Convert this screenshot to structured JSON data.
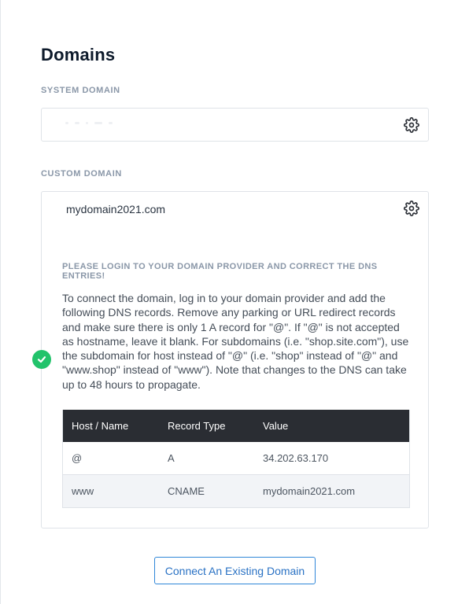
{
  "page": {
    "title": "Domains"
  },
  "system_domain": {
    "label": "SYSTEM DOMAIN",
    "settings_icon": "gear-icon"
  },
  "custom_domain": {
    "label": "CUSTOM DOMAIN",
    "value": "mydomain2021.com",
    "settings_icon": "gear-icon",
    "status_icon": "check-circle-icon",
    "status_color": "#22c36b",
    "warning_title": "PLEASE LOGIN TO YOUR DOMAIN PROVIDER AND CORRECT THE DNS ENTRIES!",
    "instructions": "To connect the domain, log in to your domain provider and add the following DNS records. Remove any parking or URL redirect records and make sure there is only 1 A record for \"@\". If \"@\" is not accepted as hostname, leave it blank. For subdomains (i.e. \"shop.site.com\"), use the subdomain for host instead of \"@\" (i.e. \"shop\" instead of \"@\" and \"www.shop\" instead of \"www\"). Note that changes to the DNS can take up to 48 hours to propagate."
  },
  "dns_table": {
    "headers": [
      "Host / Name",
      "Record Type",
      "Value"
    ],
    "rows": [
      [
        "@",
        "A",
        "34.202.63.170"
      ],
      [
        "www",
        "CNAME",
        "mydomain2021.com"
      ]
    ]
  },
  "actions": {
    "connect_label": "Connect An Existing Domain",
    "accent_color": "#2f86d8"
  }
}
